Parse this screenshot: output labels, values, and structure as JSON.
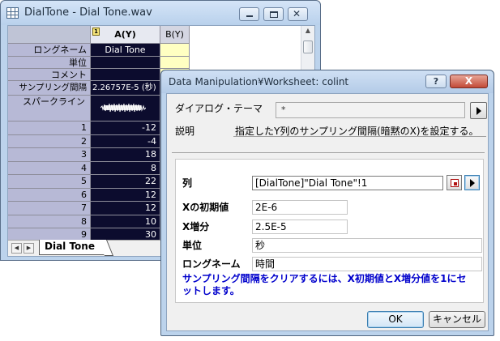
{
  "worksheet": {
    "title": "DialTone - Dial Tone.wav",
    "columns": [
      {
        "header": "A(Y)"
      },
      {
        "header": "B(Y)"
      }
    ],
    "meta_rows": [
      {
        "label": "ロングネーム",
        "a": "Dial Tone"
      },
      {
        "label": "単位",
        "a": ""
      },
      {
        "label": "コメント",
        "a": ""
      },
      {
        "label": "サンプリング間隔",
        "a": "2.26757E-5 (秒)"
      },
      {
        "label": "スパークライン",
        "a": ""
      }
    ],
    "data_rows": [
      {
        "row": "1",
        "a": "-12"
      },
      {
        "row": "2",
        "a": "-4"
      },
      {
        "row": "3",
        "a": "18"
      },
      {
        "row": "4",
        "a": "8"
      },
      {
        "row": "5",
        "a": "22"
      },
      {
        "row": "6",
        "a": "12"
      },
      {
        "row": "7",
        "a": "12"
      },
      {
        "row": "8",
        "a": "10"
      },
      {
        "row": "9",
        "a": "30"
      }
    ],
    "sheet_tab": "Dial Tone",
    "column_marker": "1"
  },
  "dialog": {
    "title": "Data Manipulation¥Worksheet: colint",
    "help_glyph": "?",
    "close_glyph": "X",
    "theme_label": "ダイアログ・テーマ",
    "theme_value": "*",
    "desc_label": "説明",
    "desc_text": "指定したY列のサンプリング間隔(暗黙のX)を設定する。",
    "fields": {
      "column": {
        "label": "列",
        "value": "[DialTone]\"Dial Tone\"!1"
      },
      "x_initial": {
        "label": "Xの初期値",
        "value": "2E-6"
      },
      "x_increment": {
        "label": "X増分",
        "value": "2.5E-5"
      },
      "unit": {
        "label": "単位",
        "value": "秒"
      },
      "long_name": {
        "label": "ロングネーム",
        "value": "時間"
      }
    },
    "note": "サンプリング間隔をクリアするには、X初期値とX増分値を1にセットします。",
    "ok_label": "OK",
    "cancel_label": "キャンセル"
  },
  "colors": {
    "window_frame": "#bcd3ec",
    "column_a_bg": "#0c0c2e",
    "column_b_bg": "#ffffd8",
    "note_text": "#0000cc",
    "close_button": "#c24a37"
  }
}
